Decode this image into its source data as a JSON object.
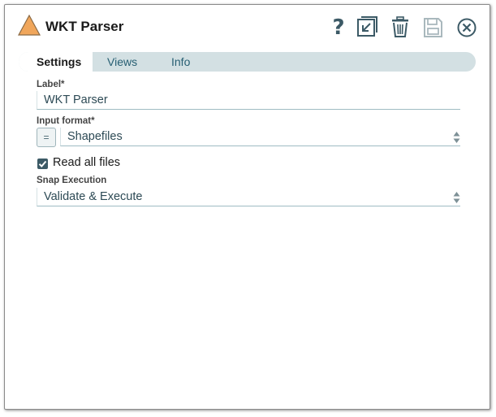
{
  "dialog": {
    "title": "WKT Parser",
    "snap_icon": "triangle-warning-icon",
    "toolbar": [
      {
        "name": "help-button",
        "icon": "question-icon"
      },
      {
        "name": "expand-button",
        "icon": "expand-icon"
      },
      {
        "name": "delete-button",
        "icon": "trash-icon"
      },
      {
        "name": "save-button",
        "icon": "save-icon"
      },
      {
        "name": "close-button",
        "icon": "close-icon"
      }
    ],
    "tabs": [
      {
        "label": "Settings",
        "active": true
      },
      {
        "label": "Views",
        "active": false
      },
      {
        "label": "Info",
        "active": false
      }
    ]
  },
  "settings": {
    "label_field": {
      "label": "Label*",
      "value": "WKT Parser"
    },
    "input_format": {
      "label": "Input format*",
      "value": "Shapefiles",
      "expr_symbol": "="
    },
    "read_all_files": {
      "label": "Read all files",
      "checked": true
    },
    "snap_execution": {
      "label": "Snap Execution",
      "value": "Validate & Execute"
    }
  },
  "colors": {
    "accent": "#3c5a66",
    "tab_bar": "#d3e0e3",
    "warning_icon": "#f0a65b"
  }
}
